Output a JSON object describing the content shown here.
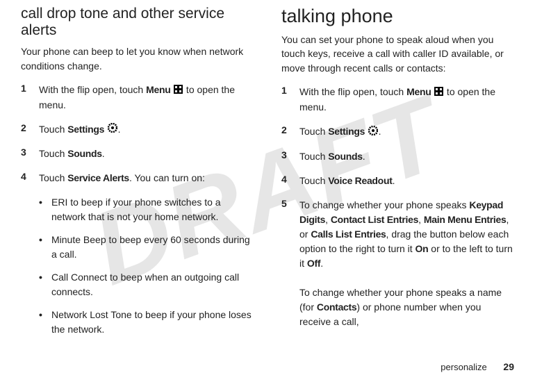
{
  "watermark": "DRAFT",
  "left": {
    "heading": "call drop tone and other service alerts",
    "intro": "Your phone can beep to let you know when network conditions change.",
    "steps": [
      {
        "num": "1",
        "pre": "With the flip open, touch ",
        "bold": "Menu ",
        "icon": "grid",
        "post": " to open the menu."
      },
      {
        "num": "2",
        "pre": "Touch ",
        "bold": "Settings ",
        "icon": "gear",
        "post": "."
      },
      {
        "num": "3",
        "pre": "Touch ",
        "bold": "Sounds",
        "post": "."
      },
      {
        "num": "4",
        "pre": "Touch ",
        "bold": "Service Alerts",
        "post": ". You can turn on:"
      }
    ],
    "bullets": [
      {
        "bold": "ERI",
        "text": " to beep if your phone switches to a network that is not your home network."
      },
      {
        "bold": "Minute Beep",
        "text": " to beep every 60 seconds during a call."
      },
      {
        "bold": "Call Connect",
        "text": " to beep when an outgoing call connects."
      },
      {
        "bold": "Network Lost Tone",
        "text": " to beep if your phone loses the network."
      }
    ]
  },
  "right": {
    "heading": "talking phone",
    "intro_parts": {
      "a": "You can set your phone to ",
      "b": "speak aloud",
      "c": " when you touch keys, receive a call with caller ID available, or move through recent calls or contacts:"
    },
    "steps": [
      {
        "num": "1",
        "pre": "With the flip open, touch ",
        "bold": "Menu ",
        "icon": "grid",
        "post": " to open the menu."
      },
      {
        "num": "2",
        "pre": "Touch ",
        "bold": "Settings ",
        "icon": "gear",
        "post": "."
      },
      {
        "num": "3",
        "pre": "Touch ",
        "bold": "Sounds",
        "post": "."
      },
      {
        "num": "4",
        "pre": "Touch ",
        "bold": "Voice Readout",
        "post": "."
      }
    ],
    "step5": {
      "num": "5",
      "a": "To change whether your phone speaks ",
      "kp": "Keypad Digits",
      "c1": ", ",
      "cle": "Contact List Entries",
      "c2": ", ",
      "mme": "Main Menu Entries",
      "c3": ", or ",
      "clle": "Calls List Entries",
      "d": ", drag the button below each option to the right to turn it ",
      "on": "On",
      "e": " or to the left to turn it ",
      "off": "Off",
      "f": "."
    },
    "para2": {
      "a": "To change whether your phone speaks a name (for ",
      "contacts": "Contacts",
      "b": ") or phone number when you receive a call,"
    }
  },
  "footer": {
    "label": "personalize",
    "page": "29"
  }
}
